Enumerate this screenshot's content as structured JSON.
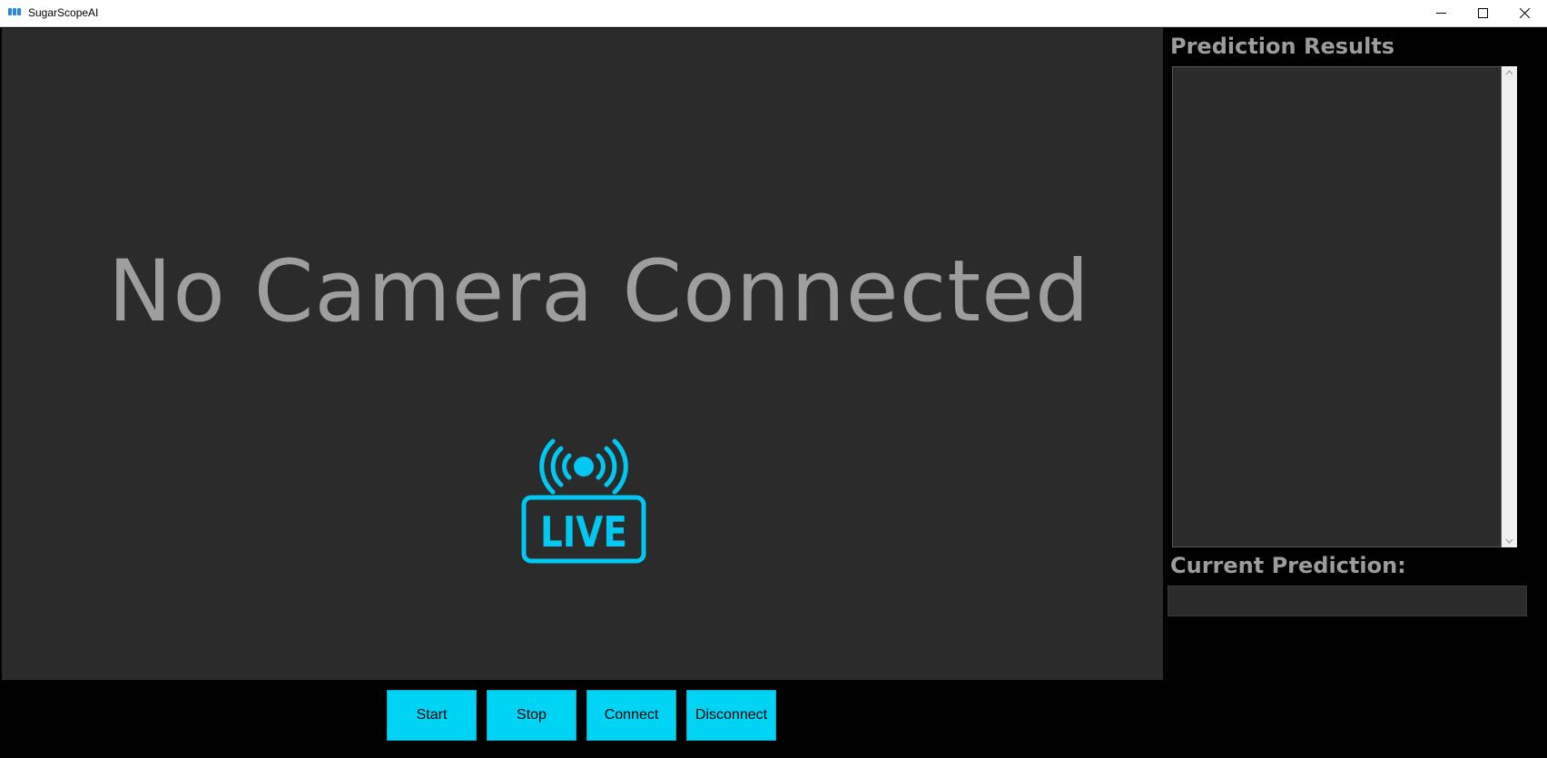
{
  "window": {
    "title": "SugarScopeAI"
  },
  "video": {
    "status_text": "No Camera Connected",
    "live_badge_text": "LIVE",
    "accent_color": "#00c8f0"
  },
  "controls": {
    "start_label": "Start",
    "stop_label": "Stop",
    "connect_label": "Connect",
    "disconnect_label": "Disconnect",
    "button_color": "#00d4f5"
  },
  "results": {
    "title": "Prediction Results",
    "items": [],
    "current_label": "Current Prediction:",
    "current_value": ""
  }
}
